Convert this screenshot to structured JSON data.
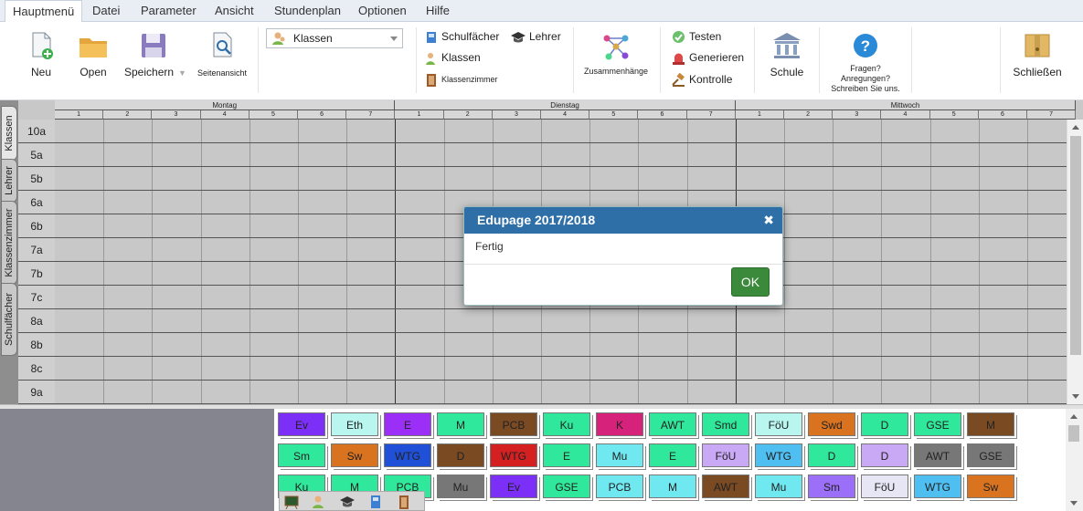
{
  "menu": {
    "tabs": [
      "Hauptmenü",
      "Datei",
      "Parameter",
      "Ansicht",
      "Stundenplan",
      "Optionen",
      "Hilfe"
    ],
    "active": 0
  },
  "ribbon": {
    "new_label": "Neu",
    "open_label": "Open",
    "save_label": "Speichern",
    "preview_label": "Seitenansicht",
    "view_select_value": "Klassen",
    "subjects_label": "Schulfächer",
    "teachers_label": "Lehrer",
    "classes_label": "Klassen",
    "rooms_label": "Klassenzimmer",
    "relations_label": "Zusammenhänge",
    "test_label": "Testen",
    "generate_label": "Generieren",
    "check_label": "Kontrolle",
    "school_label": "Schule",
    "feedback_line1": "Fragen?",
    "feedback_line2": "Anregungen?",
    "feedback_line3": "Schreiben Sie uns.",
    "close_label": "Schließen"
  },
  "side_tabs": [
    "Klassen",
    "Lehrer",
    "Klassenzimmer",
    "Schulfächer"
  ],
  "timetable": {
    "days": [
      "Montag",
      "Dienstag",
      "Mittwoch"
    ],
    "periods": [
      "1",
      "2",
      "3",
      "4",
      "5",
      "6",
      "7"
    ],
    "classes": [
      "10a",
      "5a",
      "5b",
      "6a",
      "6b",
      "7a",
      "7b",
      "7c",
      "8a",
      "8b",
      "8c",
      "9a"
    ]
  },
  "cards": [
    [
      {
        "t": "Ev",
        "c": "#7b2ff7"
      },
      {
        "t": "Eth",
        "c": "#b9f6f0"
      },
      {
        "t": "E",
        "c": "#9b2ff7"
      },
      {
        "t": "M",
        "c": "#2fe89b"
      },
      {
        "t": "PCB",
        "c": "#7a4a22"
      },
      {
        "t": "Ku",
        "c": "#2fe89b"
      },
      {
        "t": "K",
        "c": "#d6227a"
      },
      {
        "t": "AWT",
        "c": "#2fe89b"
      },
      {
        "t": "Smd",
        "c": "#2fe89b"
      },
      {
        "t": "FöU",
        "c": "#b9f6f0"
      },
      {
        "t": "Swd",
        "c": "#d9731f"
      },
      {
        "t": "D",
        "c": "#2fe89b"
      },
      {
        "t": "GSE",
        "c": "#2fe89b"
      },
      {
        "t": "M",
        "c": "#7a4a22"
      }
    ],
    [
      {
        "t": "Sm",
        "c": "#2fe89b"
      },
      {
        "t": "Sw",
        "c": "#d9731f"
      },
      {
        "t": "WTG",
        "c": "#2050d8"
      },
      {
        "t": "D",
        "c": "#7a4a22"
      },
      {
        "t": "WTG",
        "c": "#d42020"
      },
      {
        "t": "E",
        "c": "#2fe89b"
      },
      {
        "t": "Mu",
        "c": "#6fe8f0"
      },
      {
        "t": "E",
        "c": "#2fe89b"
      },
      {
        "t": "FöU",
        "c": "#c9a8f5"
      },
      {
        "t": "WTG",
        "c": "#4fbef0"
      },
      {
        "t": "D",
        "c": "#2fe89b"
      },
      {
        "t": "D",
        "c": "#c9a8f5"
      },
      {
        "t": "AWT",
        "c": "#777777"
      },
      {
        "t": "GSE",
        "c": "#777777"
      }
    ],
    [
      {
        "t": "Ku",
        "c": "#2fe89b"
      },
      {
        "t": "M",
        "c": "#2fe89b"
      },
      {
        "t": "PCB",
        "c": "#2fe89b"
      },
      {
        "t": "Mu",
        "c": "#777777"
      },
      {
        "t": "Ev",
        "c": "#7b2ff7"
      },
      {
        "t": "GSE",
        "c": "#2fe89b"
      },
      {
        "t": "PCB",
        "c": "#6fe8f0"
      },
      {
        "t": "M",
        "c": "#6fe8f0"
      },
      {
        "t": "AWT",
        "c": "#7a4a22"
      },
      {
        "t": "Mu",
        "c": "#6fe8f0"
      },
      {
        "t": "Sm",
        "c": "#9b6ff7"
      },
      {
        "t": "FöU",
        "c": "#e6e6f5"
      },
      {
        "t": "WTG",
        "c": "#4fbef0"
      },
      {
        "t": "Sw",
        "c": "#d9731f"
      }
    ]
  ],
  "dialog": {
    "title": "Edupage 2017/2018",
    "close": "✖",
    "message": "Fertig",
    "ok": "OK"
  },
  "colors": {
    "accent": "#2f6fa8",
    "ok": "#3b8a3b"
  }
}
